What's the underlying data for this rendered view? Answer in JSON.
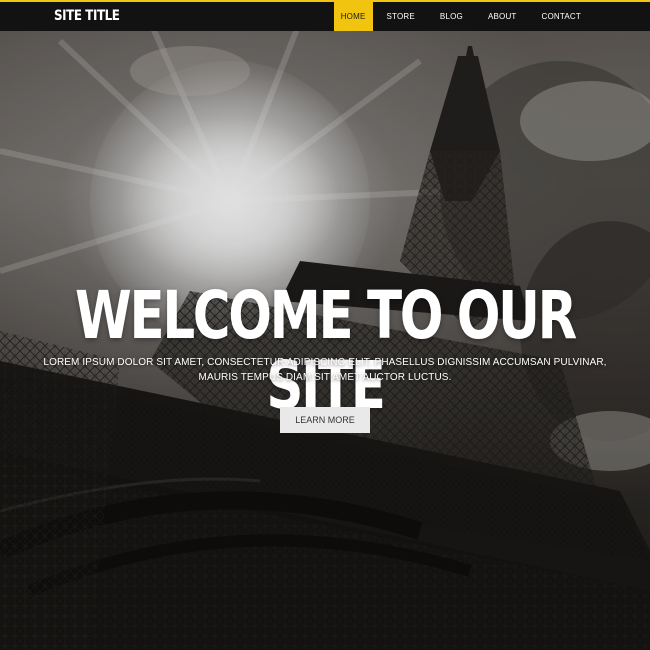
{
  "header": {
    "site_title": "SITE TITLE",
    "accent_color": "#f1c40f",
    "nav": [
      {
        "label": "HOME",
        "active": true
      },
      {
        "label": "STORE",
        "active": false
      },
      {
        "label": "BLOG",
        "active": false
      },
      {
        "label": "ABOUT",
        "active": false
      },
      {
        "label": "CONTACT",
        "active": false
      }
    ]
  },
  "hero": {
    "title": "WELCOME TO OUR SITE",
    "subtitle_line1": "LOREM IPSUM DOLOR SIT AMET, CONSECTETUR ADIPISCING ELIT. PHASELLUS DIGNISSIM ACCUMSAN PULVINAR,",
    "subtitle_line2": "MAURIS TEMPUS DIAM SIT AMET AUCTOR LUCTUS.",
    "cta_label": "LEARN MORE"
  }
}
